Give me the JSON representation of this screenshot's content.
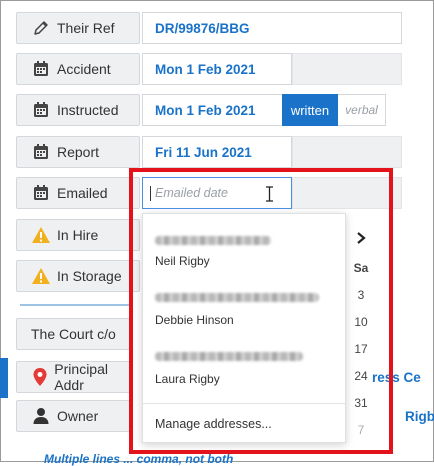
{
  "fields": {
    "their_ref": {
      "label": "Their Ref",
      "value": "DR/99876/BBG"
    },
    "accident": {
      "label": "Accident",
      "value": "Mon 1 Feb 2021"
    },
    "instructed": {
      "label": "Instructed",
      "value": "Mon 1 Feb 2021",
      "written_label": "written",
      "verbal_label": "verbal"
    },
    "report": {
      "label": "Report",
      "value": "Fri 11 Jun 2021"
    },
    "emailed": {
      "label": "Emailed",
      "placeholder": "Emailed date"
    },
    "in_hire": {
      "label": "In Hire"
    },
    "in_storage": {
      "label": "In Storage"
    },
    "court": {
      "label": "The Court c/o"
    },
    "principal": {
      "label": "Principal Addr",
      "overflow": "ress Ce"
    },
    "owner": {
      "label": "Owner",
      "overflow": "Rigb"
    }
  },
  "dropdown": {
    "contacts": [
      {
        "name": "Neil Rigby"
      },
      {
        "name": "Debbie Hinson"
      },
      {
        "name": "Laura Rigby"
      }
    ],
    "manage_label": "Manage addresses..."
  },
  "calendar": {
    "header": "Sa",
    "days": [
      "3",
      "10",
      "17",
      "24",
      "31",
      "7"
    ]
  },
  "footer_text": "Multiple lines ... comma, not both",
  "colors": {
    "accent": "#1a73c8",
    "highlight": "#e3121b",
    "warning": "#f2b01e",
    "pin": "#e53935"
  }
}
